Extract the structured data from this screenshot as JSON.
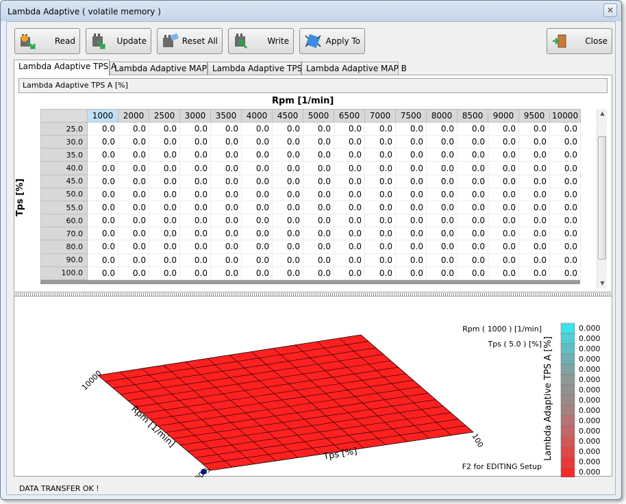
{
  "window": {
    "title": "Lambda Adaptive ( volatile memory )",
    "close_glyph": "✕"
  },
  "toolbar": {
    "read": "Read",
    "update": "Update",
    "reset_all": "Reset All",
    "write": "Write",
    "apply_to": "Apply To",
    "close": "Close"
  },
  "tabs": [
    "Lambda Adaptive TPS A",
    "Lambda Adaptive MAP A",
    "Lambda Adaptive TPS B",
    "Lambda Adaptive MAP B"
  ],
  "panel": {
    "header": "Lambda Adaptive TPS A [%]",
    "col_axis_label": "Rpm  [1/min]",
    "row_axis_label": "Tps  [%]",
    "columns": [
      "1000",
      "2000",
      "2500",
      "3000",
      "3500",
      "4000",
      "4500",
      "5000",
      "6500",
      "7000",
      "7500",
      "8000",
      "8500",
      "9000",
      "9500",
      "10000"
    ],
    "rows": [
      "25.0",
      "30.0",
      "35.0",
      "40.0",
      "45.0",
      "50.0",
      "55.0",
      "60.0",
      "70.0",
      "80.0",
      "90.0",
      "100.0"
    ],
    "cell_value": "0.0",
    "selected_column": "1000"
  },
  "plot": {
    "rpm_readout": "Rpm ( 1000 ) [1/min]",
    "tps_readout": "Tps ( 5.0 ) [%]",
    "hint": "F2 for EDITING Setup",
    "legend_title": "Lambda Adaptive TPS A  [%]",
    "legend_values": [
      "0.000",
      "0.000",
      "0.000",
      "0.000",
      "0.000",
      "0.000",
      "0.000",
      "0.000",
      "0.000",
      "0.000",
      "0.000",
      "0.000",
      "0.000",
      "0.000",
      "0.000",
      "0.000"
    ],
    "legend_colors": [
      "#40e0e8",
      "#50cfd6",
      "#5fbfc4",
      "#6fb0b2",
      "#7ea4a2",
      "#8c9a93",
      "#949090",
      "#9a8a88",
      "#a88080",
      "#b67474",
      "#c46666",
      "#d25858",
      "#de4848",
      "#ea3838",
      "#f22a2a",
      "#ff1c1c"
    ],
    "surface_color": "#ff2020",
    "axis_rpm_label": "Rpm  [1/min]",
    "axis_tps_label": "Tps  [%]",
    "rpm_min": "1000",
    "rpm_max": "10000",
    "tps_min": "5",
    "tps_max": "100"
  },
  "status": "DATA TRANSFER OK !"
}
